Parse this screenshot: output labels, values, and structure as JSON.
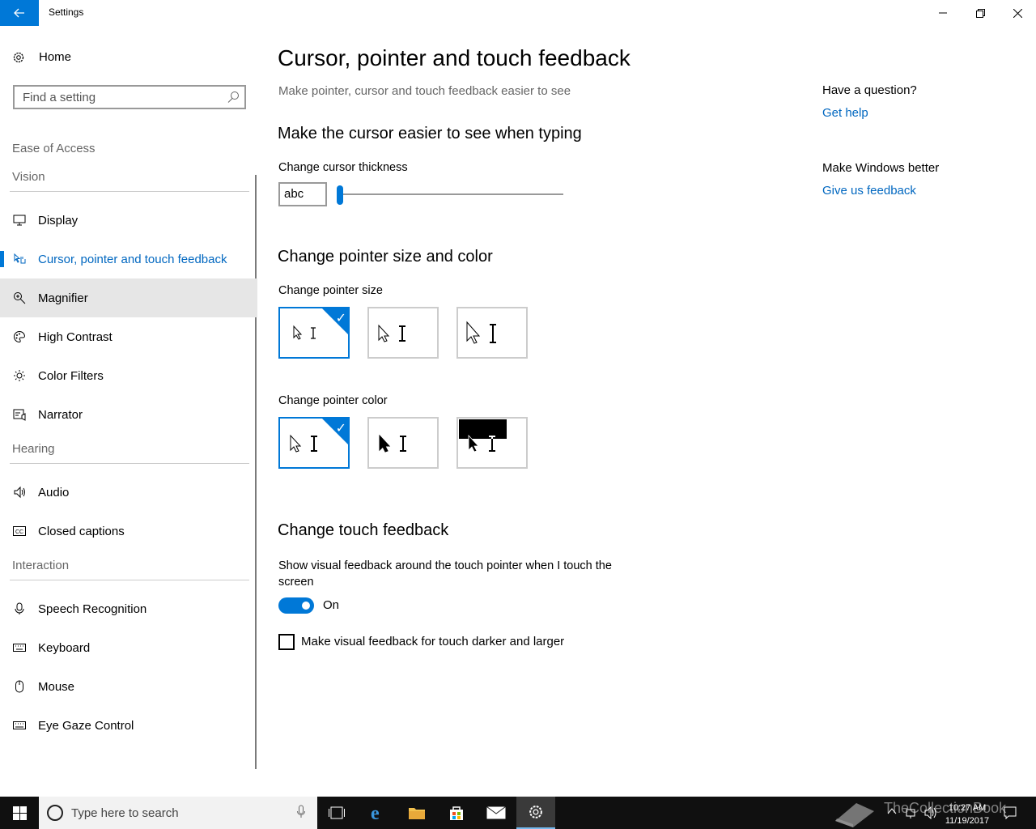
{
  "window": {
    "title": "Settings"
  },
  "sidebar": {
    "home_label": "Home",
    "search_placeholder": "Find a setting",
    "category": "Ease of Access",
    "sections": {
      "vision": "Vision",
      "hearing": "Hearing",
      "interaction": "Interaction"
    },
    "items": [
      {
        "label": "Display",
        "icon": "monitor-icon"
      },
      {
        "label": "Cursor, pointer and touch feedback",
        "icon": "pointer-hand-icon",
        "active": true
      },
      {
        "label": "Magnifier",
        "icon": "magnifier-icon",
        "hover": true
      },
      {
        "label": "High Contrast",
        "icon": "palette-icon"
      },
      {
        "label": "Color Filters",
        "icon": "sun-icon"
      },
      {
        "label": "Narrator",
        "icon": "narrator-icon"
      },
      {
        "label": "Audio",
        "icon": "speaker-icon"
      },
      {
        "label": "Closed captions",
        "icon": "cc-icon"
      },
      {
        "label": "Speech Recognition",
        "icon": "microphone-icon"
      },
      {
        "label": "Keyboard",
        "icon": "keyboard-icon"
      },
      {
        "label": "Mouse",
        "icon": "mouse-icon"
      },
      {
        "label": "Eye Gaze Control",
        "icon": "eye-gaze-keyboard-icon"
      }
    ]
  },
  "main": {
    "title": "Cursor, pointer and touch feedback",
    "subtitle": "Make pointer, cursor and touch feedback easier to see",
    "cursor_section": {
      "heading": "Make the cursor easier to see when typing",
      "thickness_label": "Change cursor thickness",
      "preview_text": "abc",
      "thickness_value": 1
    },
    "pointer_section": {
      "heading": "Change pointer size and color",
      "size_label": "Change pointer size",
      "size_options": [
        "small",
        "medium",
        "large"
      ],
      "size_selected": 0,
      "color_label": "Change pointer color",
      "color_options": [
        "white",
        "black",
        "inverted"
      ],
      "color_selected": 0
    },
    "touch_section": {
      "heading": "Change touch feedback",
      "visual_feedback_label": "Show visual feedback around the touch pointer when I touch the screen",
      "toggle_state": "On",
      "darker_label": "Make visual feedback for touch darker and larger",
      "darker_checked": false
    }
  },
  "aside": {
    "question": "Have a question?",
    "get_help": "Get help",
    "better": "Make Windows better",
    "feedback": "Give us feedback"
  },
  "taskbar": {
    "search_placeholder": "Type here to search",
    "time": "10:27 AM",
    "date": "11/19/2017",
    "watermark": "TheCollectionBook"
  },
  "colors": {
    "accent": "#0078d7",
    "link": "#0067c0"
  }
}
